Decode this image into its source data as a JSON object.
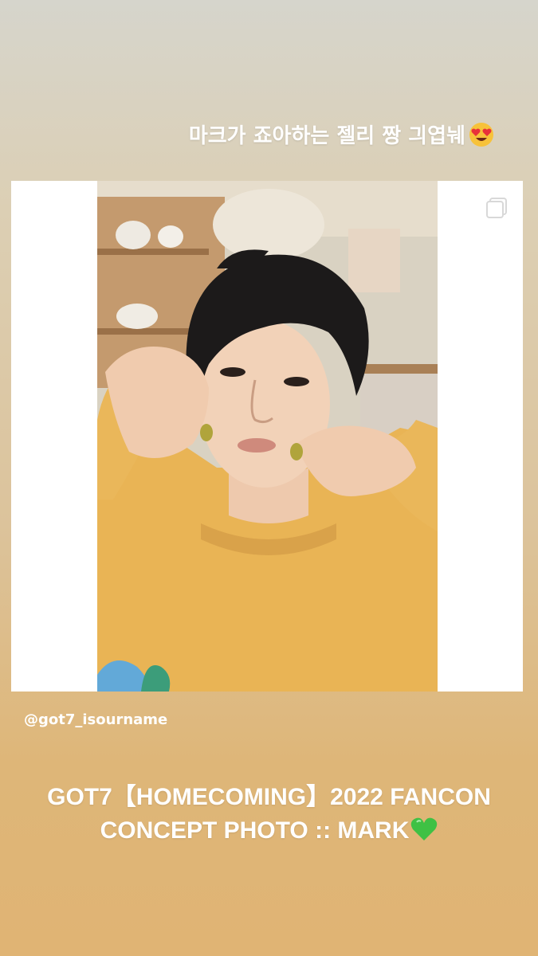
{
  "story": {
    "top_caption": "마크가 죠아하는 젤리 짱 긔엽눼",
    "top_caption_emoji": "heart-eyes-emoji",
    "handle": "@got7_isourname",
    "bottom_caption_line1": "GOT7【HOMECOMING】2022 FANCON",
    "bottom_caption_line2": "CONCEPT PHOTO :: MARK",
    "bottom_caption_emoji": "green-heart-emoji"
  },
  "post": {
    "photo_icon": "person-portrait",
    "corner_icon": "multi-photo-icon"
  },
  "colors": {
    "sweater": "#e9b455",
    "hair": "#1c1a1a",
    "skin": "#f2d2b8",
    "green_heart": "#3fc144",
    "text": "#ffffff"
  }
}
